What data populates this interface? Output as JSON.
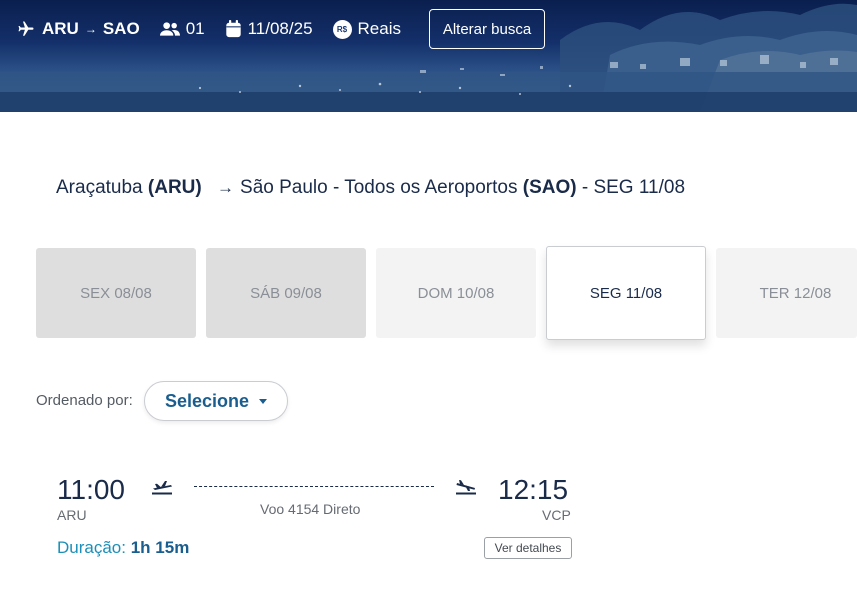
{
  "header": {
    "origin_code": "ARU",
    "destination_code": "SAO",
    "passengers": "01",
    "date": "11/08/25",
    "currency_symbol": "R$",
    "currency": "Reais",
    "change_search_label": "Alterar busca",
    "icons": [
      "plane-icon",
      "passengers-icon",
      "calendar-icon",
      "currency-icon"
    ]
  },
  "route": {
    "origin_city": "Araçatuba",
    "origin_code": "(ARU)",
    "destination_city": "São Paulo - Todos os Aeroportos",
    "destination_code": "(SAO)",
    "date_suffix": "- SEG 11/08"
  },
  "date_tabs": [
    {
      "label": "SEX 08/08",
      "state": "unavailable"
    },
    {
      "label": "SÁB 09/08",
      "state": "unavailable"
    },
    {
      "label": "DOM 10/08",
      "state": "available"
    },
    {
      "label": "SEG 11/08",
      "state": "selected"
    },
    {
      "label": "TER 12/08",
      "state": "available"
    }
  ],
  "sort": {
    "label": "Ordenado por:",
    "value": "Selecione"
  },
  "flight": {
    "departure_time": "11:00",
    "departure_code": "ARU",
    "arrival_time": "12:15",
    "arrival_code": "VCP",
    "info": "Voo 4154 Direto",
    "duration_label": "Duração:",
    "duration_value": "1h 15m",
    "details_label": "Ver detalhes"
  },
  "colors": {
    "primary_text": "#1a2b4a",
    "accent": "#1a5e8f",
    "duration_color": "#1b8fb8",
    "tab_unavailable": "#dedede",
    "tab_available": "#f3f3f3"
  }
}
